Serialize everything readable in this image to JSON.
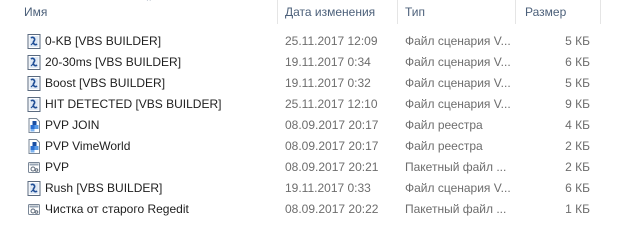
{
  "columns": {
    "name": "Имя",
    "date": "Дата изменения",
    "type": "Тип",
    "size": "Размер"
  },
  "files": [
    {
      "name": "0-KB [VBS BUILDER]",
      "date": "25.11.2017 12:09",
      "type": "Файл сценария V...",
      "size": "5 КБ",
      "icon": "vbs-script-icon"
    },
    {
      "name": "20-30ms  [VBS BUILDER]",
      "date": "19.11.2017 0:34",
      "type": "Файл сценария V...",
      "size": "6 КБ",
      "icon": "vbs-script-icon"
    },
    {
      "name": "Boost [VBS BUILDER]",
      "date": "19.11.2017 0:32",
      "type": "Файл сценария V...",
      "size": "5 КБ",
      "icon": "vbs-script-icon"
    },
    {
      "name": "HIT DETECTED [VBS BUILDER]",
      "date": "25.11.2017 12:10",
      "type": "Файл сценария V...",
      "size": "9 КБ",
      "icon": "vbs-script-icon"
    },
    {
      "name": "PVP JOIN",
      "date": "08.09.2017 20:17",
      "type": "Файл реестра",
      "size": "4 КБ",
      "icon": "registry-file-icon"
    },
    {
      "name": "PVP VimeWorld",
      "date": "08.09.2017 20:17",
      "type": "Файл реестра",
      "size": "2 КБ",
      "icon": "registry-file-icon"
    },
    {
      "name": "PVP",
      "date": "08.09.2017 20:21",
      "type": "Пакетный файл ...",
      "size": "2 КБ",
      "icon": "batch-file-icon"
    },
    {
      "name": "Rush [VBS BUILDER]",
      "date": "19.11.2017 0:33",
      "type": "Файл сценария V...",
      "size": "6 КБ",
      "icon": "vbs-script-icon"
    },
    {
      "name": "Чистка от старого Regedit",
      "date": "08.09.2017 20:22",
      "type": "Пакетный файл ...",
      "size": "1 КБ",
      "icon": "batch-file-icon"
    }
  ]
}
